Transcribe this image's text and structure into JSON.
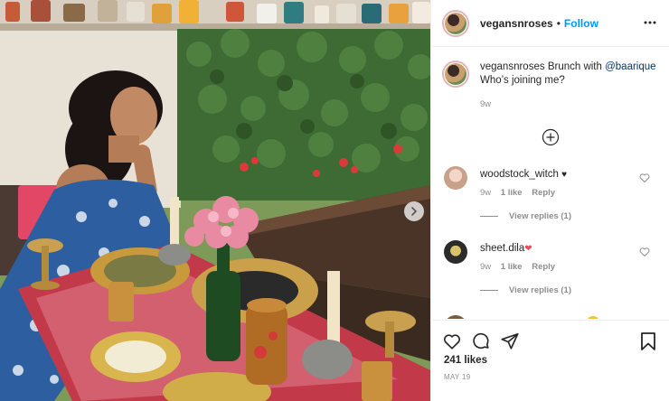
{
  "post": {
    "username": "vegansnroses",
    "follow_label": "Follow",
    "separator": "•"
  },
  "caption": {
    "username": "vegansnroses",
    "text_before": "Brunch with",
    "mention": "@baarique",
    "text_after": "Who’s joining me?",
    "time": "9w"
  },
  "comments": [
    {
      "username": "woodstock_witch",
      "emoji": "♥",
      "time": "9w",
      "likes": "1 like",
      "reply_label": "Reply",
      "view_replies": "View replies (1)"
    },
    {
      "username": "sheet.dila",
      "emoji": "❤",
      "time": "9w",
      "likes": "1 like",
      "reply_label": "Reply",
      "view_replies": "View replies (1)"
    }
  ],
  "footer": {
    "likes": "241 likes",
    "date": "MAY 19"
  },
  "icons": {
    "more": "more-horizontal-icon",
    "load_more": "plus-circle-icon",
    "like": "heart-icon",
    "comment": "comment-bubble-icon",
    "share": "paper-plane-icon",
    "save": "bookmark-icon",
    "carousel_next": "chevron-right-icon"
  },
  "colors": {
    "follow": "#0095f6",
    "mention": "#00376b",
    "secondary_text": "#8e8e8e",
    "primary_text": "#262626",
    "emoji_heart_red": "#ed4956"
  }
}
